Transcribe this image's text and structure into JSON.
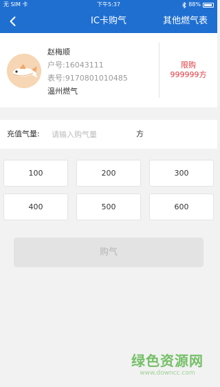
{
  "status_bar": {
    "carrier": "无 SIM 卡",
    "time": "下午5:37",
    "battery": "88%",
    "battery_level": 0.88
  },
  "nav": {
    "title": "IC卡购气",
    "right_action": "其他燃气表",
    "back_icon": "chevron-left-icon"
  },
  "account": {
    "name": "赵梅顺",
    "household": "户号:16043111",
    "meter": "表号:9170801010485",
    "company": "温州燃气",
    "limit_label": "限购",
    "limit_value": "999999方"
  },
  "purchase": {
    "label": "充值气量:",
    "placeholder": "请输入购气量",
    "unit": "方"
  },
  "amount_options": [
    "100",
    "200",
    "300",
    "400",
    "500",
    "600"
  ],
  "submit_label": "购气",
  "watermark": {
    "brand": "绿色资源网",
    "url": "www.downcc.com"
  },
  "colors": {
    "header": "#1f6fd1",
    "limit": "#e0383e",
    "button_disabled": "#e3e3e3"
  }
}
